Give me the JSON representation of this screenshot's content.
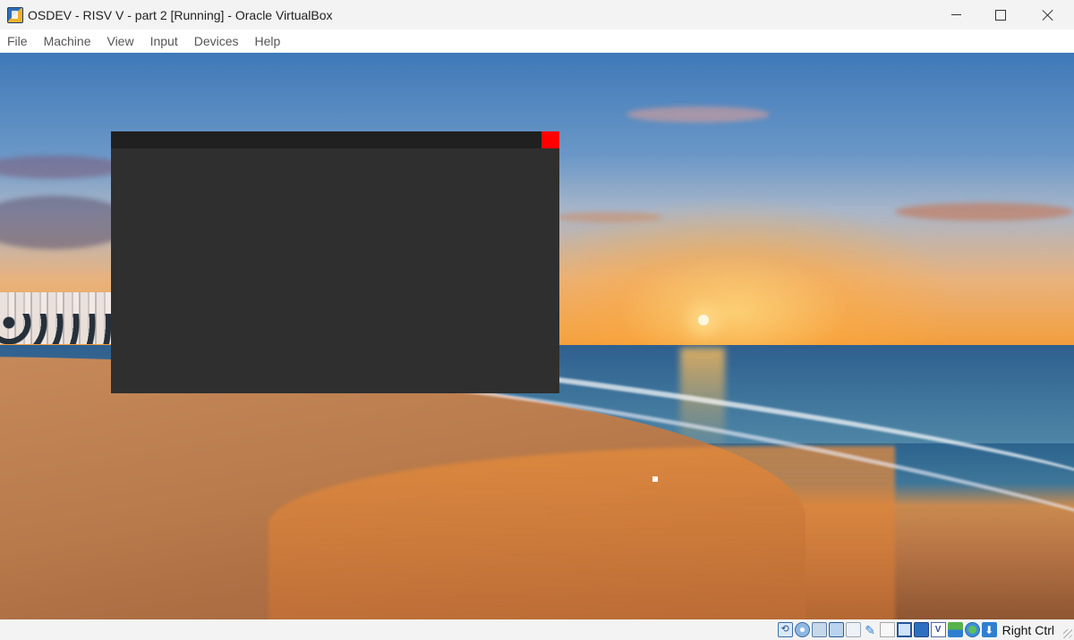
{
  "window": {
    "title": "OSDEV - RISV V - part 2 [Running] - Oracle VirtualBox",
    "icon": "virtualbox-app-icon"
  },
  "menu": {
    "items": [
      "File",
      "Machine",
      "View",
      "Input",
      "Devices",
      "Help"
    ]
  },
  "guest_window": {
    "titlebar_color": "#202020",
    "body_color": "#2f2f2f",
    "close_button_color": "#ff0000"
  },
  "statusbar": {
    "icons": [
      "hard-disk-icon",
      "optical-drive-icon",
      "audio-icon",
      "network-icon",
      "usb-icon",
      "shared-folders-icon",
      "display-icon",
      "recording-icon",
      "guest-additions-icon",
      "cpu-icon",
      "mouse-integration-icon",
      "host-key-icon"
    ],
    "host_key_label": "Right Ctrl"
  }
}
